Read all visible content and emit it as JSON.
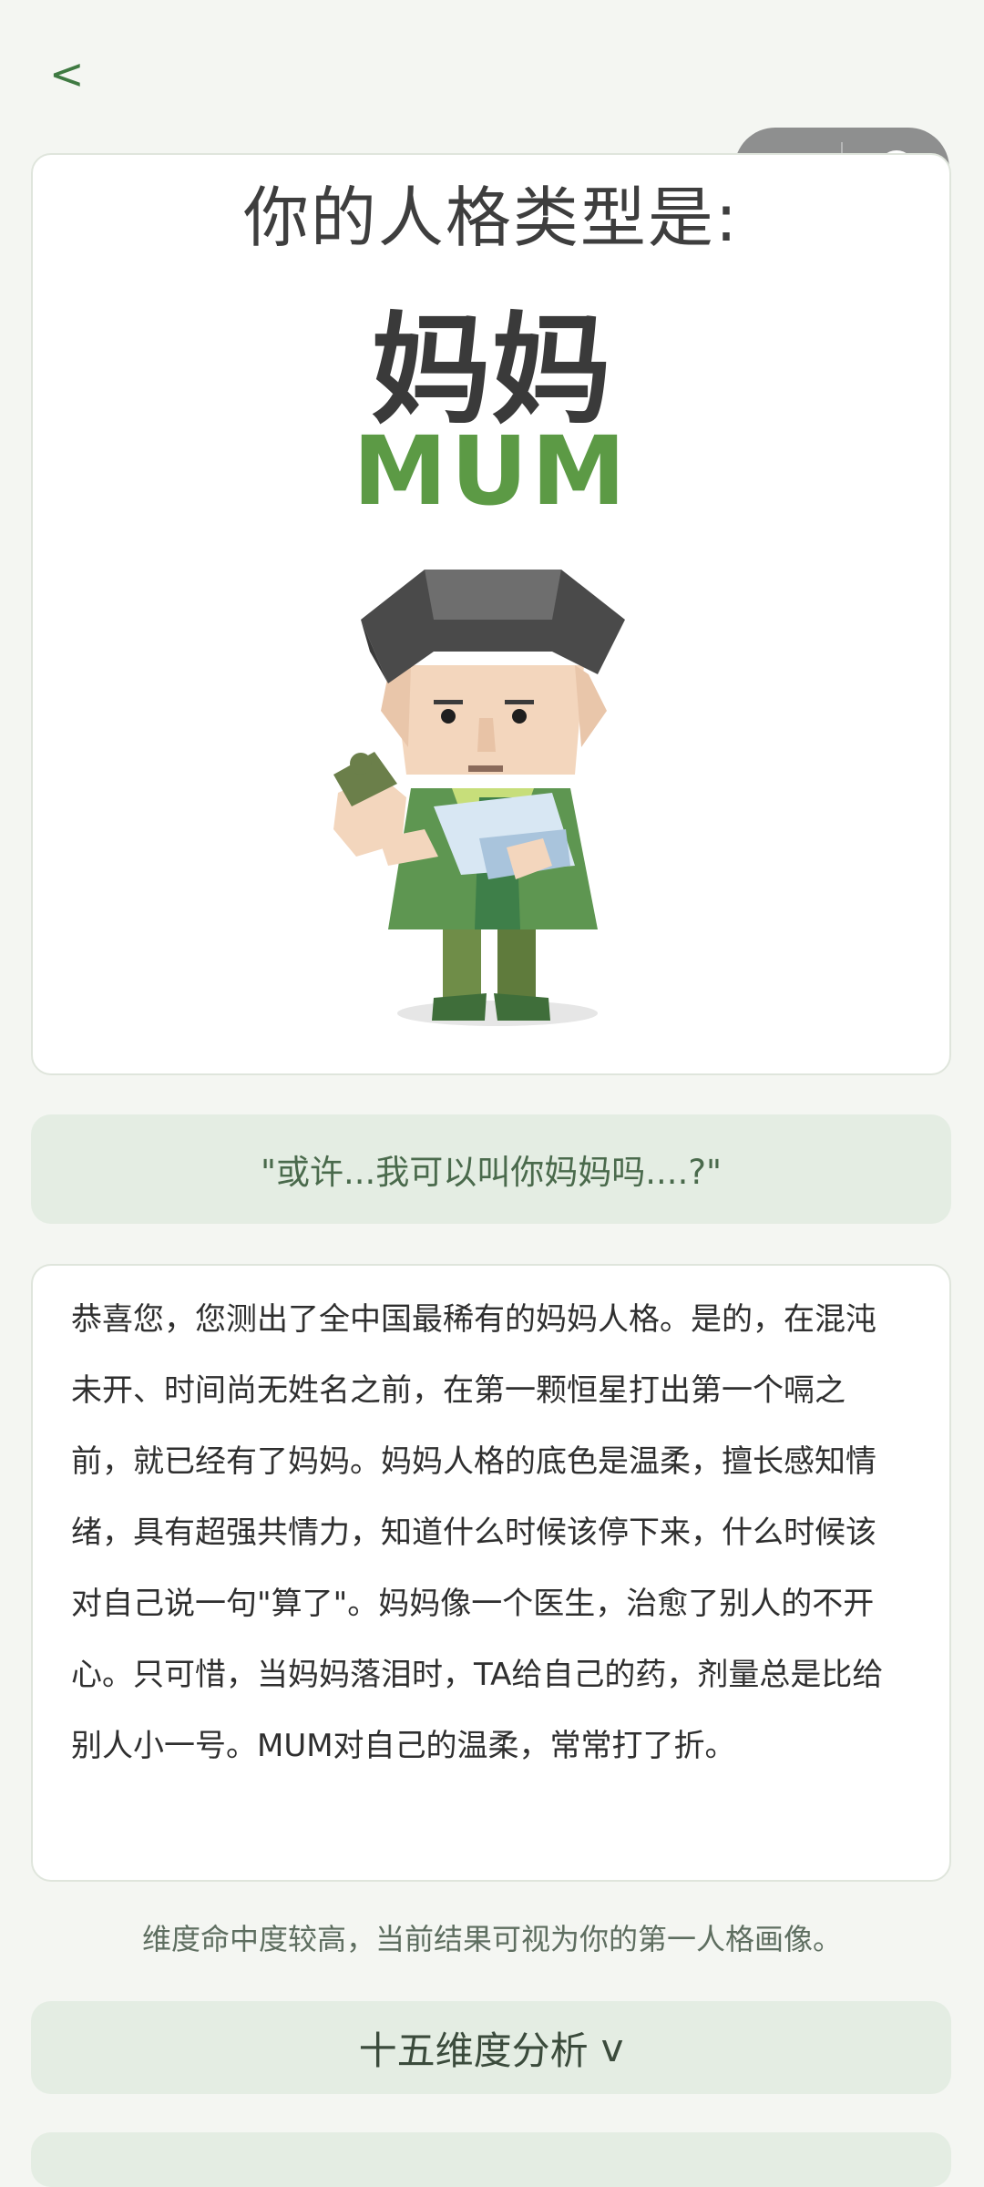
{
  "nav": {
    "back_label": "<"
  },
  "hero": {
    "heading": "你的人格类型是:",
    "type_name": "妈妈",
    "type_code": "MUM",
    "code_color": "#5c9a45"
  },
  "quote": "\"或许...我可以叫你妈妈吗....?\"",
  "description": "恭喜您，您测出了全中国最稀有的妈妈人格。是的，在混沌未开、时间尚无姓名之前，在第一颗恒星打出第一个嗝之前，就已经有了妈妈。妈妈人格的底色是温柔，擅长感知情绪，具有超强共情力，知道什么时候该停下来，什么时候该对自己说一句\"算了\"。妈妈像一个医生，治愈了别人的不开心。只可惜，当妈妈落泪时，TA给自己的药，剂量总是比给别人小一号。MUM对自己的温柔，常常打了折。",
  "note": "维度命中度较高，当前结果可视为你的第一人格画像。",
  "analysis_button": {
    "label": "十五维度分析",
    "chevron": "v"
  },
  "icons": {
    "capsule_more": "more-dots-icon",
    "capsule_close": "target-icon"
  }
}
